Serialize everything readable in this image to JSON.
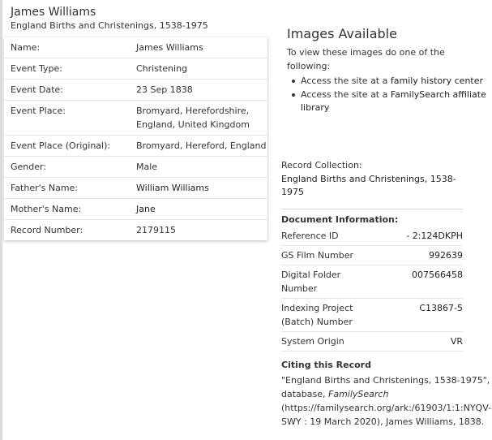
{
  "header": {
    "person_name": "James Williams",
    "collection": "England Births and Christenings, 1538-1975"
  },
  "record": {
    "rows": [
      {
        "label": "Name:",
        "value": "James Williams"
      },
      {
        "label": "Event Type:",
        "value": "Christening"
      },
      {
        "label": "Event Date:",
        "value": "23 Sep 1838"
      },
      {
        "label": "Event Place:",
        "value": "Bromyard, Herefordshire, England, United Kingdom"
      },
      {
        "label": "Event Place (Original):",
        "value": "Bromyard, Hereford, England"
      },
      {
        "label": "Gender:",
        "value": "Male"
      },
      {
        "label": "Father's Name:",
        "value": "William Williams"
      },
      {
        "label": "Mother's Name:",
        "value": "Jane"
      },
      {
        "label": "Record Number:",
        "value": "2179115"
      }
    ]
  },
  "images": {
    "title": "Images Available",
    "instructions": "To view these images do one of the following:",
    "option1_prefix": "Access the site at a ",
    "option1_link": "family history center",
    "option2_prefix": "Access the site at a ",
    "option2_link": "FamilySearch affiliate library"
  },
  "side": {
    "record_collection_label": "Record Collection:",
    "record_collection_value": "England Births and Christenings, 1538-1975",
    "document_title": "Document Information:",
    "document_rows": [
      {
        "label": "Reference ID",
        "value": "- 2:124DKPH"
      },
      {
        "label": "GS Film Number",
        "value": "992639"
      },
      {
        "label": "Digital Folder Number",
        "value": "007566458"
      },
      {
        "label": "Indexing Project (Batch) Number",
        "value": "C13867-5"
      },
      {
        "label": "System Origin",
        "value": "VR"
      }
    ],
    "citing_title": "Citing this Record",
    "citation_part1": "\"England Births and Christenings, 1538-1975\", database, ",
    "citation_italic": "FamilySearch",
    "citation_part2": " (https://familysearch.org/ark:/61903/1:1:NYQV-SWY : 19 March 2020), James Williams, 1838."
  }
}
